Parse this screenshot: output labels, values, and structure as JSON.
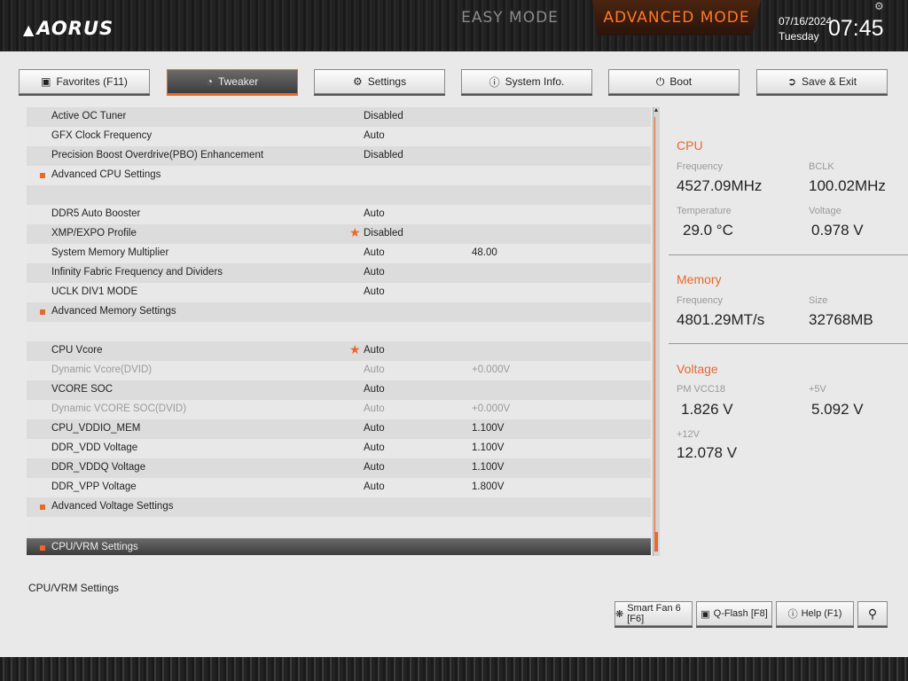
{
  "header": {
    "logo_text": "AORUS",
    "mode_easy": "EASY MODE",
    "mode_advanced": "ADVANCED MODE",
    "date": "07/16/2024",
    "weekday": "Tuesday",
    "time": "07:45"
  },
  "tabs": [
    {
      "label": "Favorites (F11)",
      "icon": "favorites-icon",
      "active": false
    },
    {
      "label": "Tweaker",
      "icon": "gauge-icon",
      "active": true
    },
    {
      "label": "Settings",
      "icon": "gear-icon",
      "active": false
    },
    {
      "label": "System Info.",
      "icon": "info-icon",
      "active": false
    },
    {
      "label": "Boot",
      "icon": "power-icon",
      "active": false
    },
    {
      "label": "Save & Exit",
      "icon": "exit-icon",
      "active": false
    }
  ],
  "settings": [
    {
      "label": "Active OC Tuner",
      "value": "Disabled",
      "extra": ""
    },
    {
      "label": "GFX Clock Frequency",
      "value": "Auto",
      "extra": ""
    },
    {
      "label": "Precision Boost Overdrive(PBO) Enhancement",
      "value": "Disabled",
      "extra": ""
    },
    {
      "label": "Advanced CPU Settings",
      "value": "",
      "extra": ""
    },
    {
      "label": "",
      "value": "",
      "extra": ""
    },
    {
      "label": "DDR5 Auto Booster",
      "value": "Auto",
      "extra": ""
    },
    {
      "label": "XMP/EXPO Profile",
      "value": "Disabled",
      "extra": ""
    },
    {
      "label": "System Memory Multiplier",
      "value": "Auto",
      "extra": "48.00"
    },
    {
      "label": "Infinity Fabric Frequency and Dividers",
      "value": "Auto",
      "extra": ""
    },
    {
      "label": "UCLK DIV1 MODE",
      "value": "Auto",
      "extra": ""
    },
    {
      "label": "Advanced Memory Settings",
      "value": "",
      "extra": ""
    },
    {
      "label": "",
      "value": "",
      "extra": ""
    },
    {
      "label": "CPU Vcore",
      "value": "Auto",
      "extra": ""
    },
    {
      "label": "Dynamic Vcore(DVID)",
      "value": "Auto",
      "extra": "+0.000V"
    },
    {
      "label": "VCORE SOC",
      "value": "Auto",
      "extra": ""
    },
    {
      "label": "Dynamic VCORE SOC(DVID)",
      "value": "Auto",
      "extra": "+0.000V"
    },
    {
      "label": "CPU_VDDIO_MEM",
      "value": "Auto",
      "extra": "1.100V"
    },
    {
      "label": "DDR_VDD Voltage",
      "value": "Auto",
      "extra": "1.100V"
    },
    {
      "label": "DDR_VDDQ Voltage",
      "value": "Auto",
      "extra": "1.100V"
    },
    {
      "label": "DDR_VPP Voltage",
      "value": "Auto",
      "extra": "1.800V"
    },
    {
      "label": "Advanced Voltage Settings",
      "value": "",
      "extra": ""
    },
    {
      "label": "",
      "value": "",
      "extra": ""
    },
    {
      "label": "CPU/VRM Settings",
      "value": "",
      "extra": ""
    }
  ],
  "monitor": {
    "cpu": {
      "title": "CPU",
      "freq_label": "Frequency",
      "freq_value": "4527.09MHz",
      "bclk_label": "BCLK",
      "bclk_value": "100.02MHz",
      "temp_label": "Temperature",
      "temp_value": "29.0 °C",
      "volt_label": "Voltage",
      "volt_value": "0.978 V"
    },
    "memory": {
      "title": "Memory",
      "freq_label": "Frequency",
      "freq_value": "4801.29MT/s",
      "size_label": "Size",
      "size_value": "32768MB"
    },
    "voltage": {
      "title": "Voltage",
      "pm_label": "PM VCC18",
      "pm_value": "1.826 V",
      "v5_label": "+5V",
      "v5_value": "5.092 V",
      "v12_label": "+12V",
      "v12_value": "12.078 V"
    }
  },
  "help_text": "CPU/VRM Settings",
  "bottom_buttons": {
    "smart_fan": "Smart Fan 6 [F6]",
    "qflash": "Q-Flash [F8]",
    "help": "Help (F1)"
  },
  "colors": {
    "accent": "#e8692a"
  }
}
